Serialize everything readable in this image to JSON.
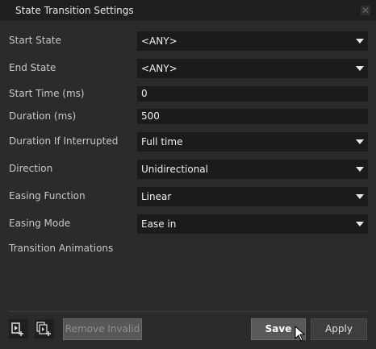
{
  "dialog": {
    "title": "State Transition Settings",
    "close_icon": "close-icon"
  },
  "fields": {
    "start_state": {
      "label": "Start State",
      "value": "<ANY>"
    },
    "end_state": {
      "label": "End State",
      "value": "<ANY>"
    },
    "start_time": {
      "label": "Start Time (ms)",
      "value": "0"
    },
    "duration": {
      "label": "Duration (ms)",
      "value": "500"
    },
    "duration_if_interrupted": {
      "label": "Duration If Interrupted",
      "value": "Full time"
    },
    "direction": {
      "label": "Direction",
      "value": "Unidirectional"
    },
    "easing_function": {
      "label": "Easing Function",
      "value": "Linear"
    },
    "easing_mode": {
      "label": "Easing Mode",
      "value": "Ease in"
    }
  },
  "transition_animations": {
    "label": "Transition Animations"
  },
  "footer": {
    "add_animation_icon": "add-animation-icon",
    "add_all_animations_icon": "add-multiple-animations-icon",
    "remove_invalid_label": "Remove Invalid",
    "save_label": "Save",
    "apply_label": "Apply"
  },
  "colors": {
    "background": "#2b2b2b",
    "field_background": "#1b1b1b",
    "titlebar": "#1f1f1f"
  }
}
